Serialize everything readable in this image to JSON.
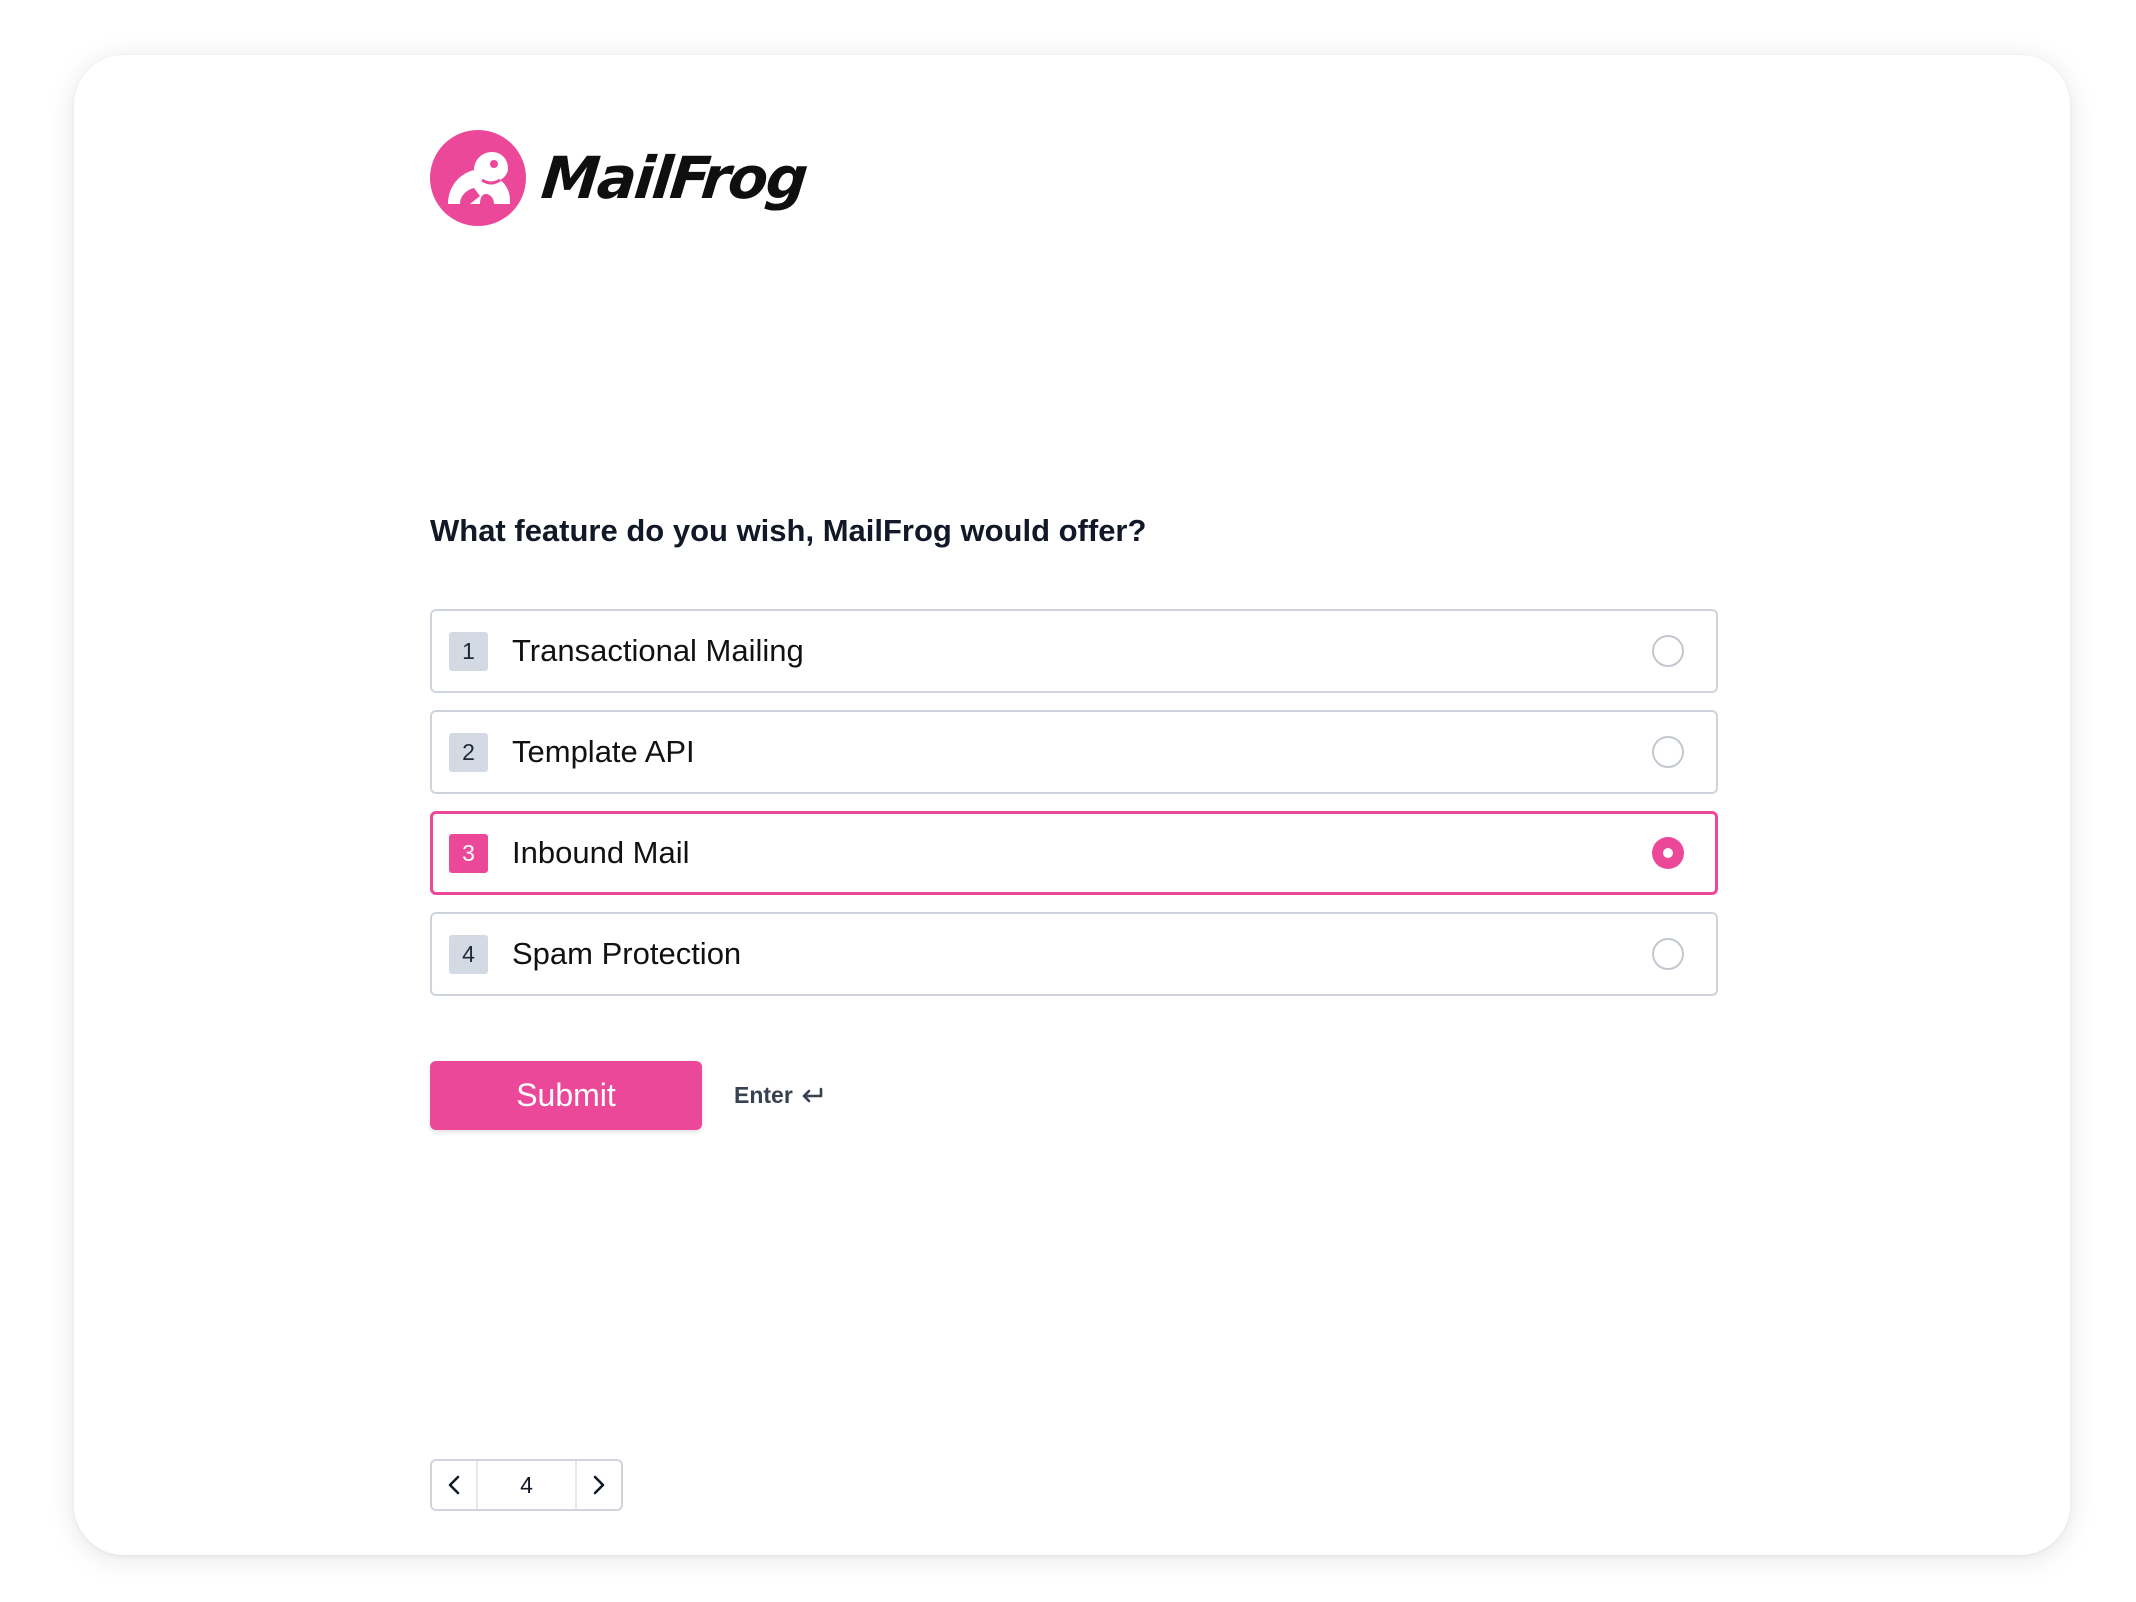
{
  "brand": {
    "name": "MailFrog",
    "accent_color": "#ec4899",
    "logo_icon": "frog-icon"
  },
  "question": {
    "text": "What feature do you wish, MailFrog would offer?"
  },
  "options": [
    {
      "key": "1",
      "label": "Transactional Mailing",
      "selected": false
    },
    {
      "key": "2",
      "label": "Template API",
      "selected": false
    },
    {
      "key": "3",
      "label": "Inbound Mail",
      "selected": true
    },
    {
      "key": "4",
      "label": "Spam Protection",
      "selected": false
    }
  ],
  "actions": {
    "submit_label": "Submit",
    "hint_label": "Enter",
    "hint_icon": "enter-return-icon"
  },
  "pagination": {
    "current_page": "4",
    "prev_icon": "chevron-left-icon",
    "next_icon": "chevron-right-icon"
  }
}
